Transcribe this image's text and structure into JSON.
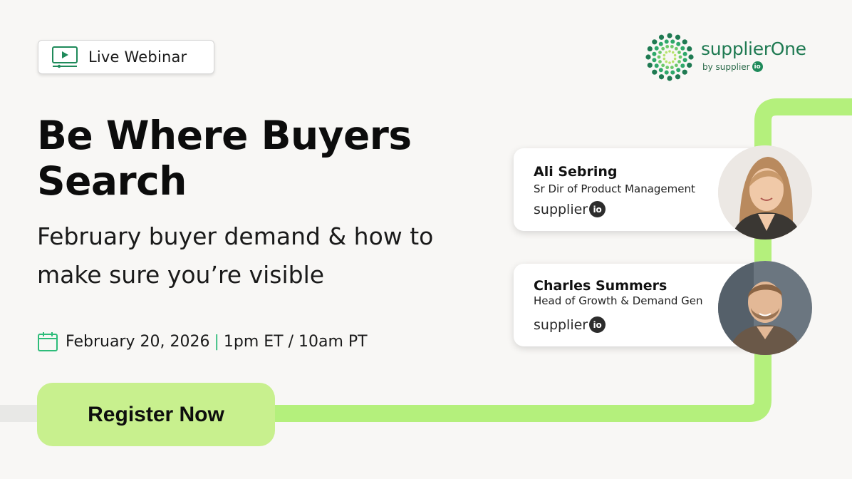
{
  "badge": {
    "label": "Live Webinar",
    "icon": "video-play-icon"
  },
  "logo": {
    "name": "supplierOne",
    "byline": "by supplier",
    "byline_mark": "io"
  },
  "headline": {
    "title": "Be Where Buyers Search"
  },
  "subheadline": {
    "text": "February buyer demand & how to make sure you’re visible"
  },
  "event": {
    "date": "February 20, 2026",
    "separator": "|",
    "time": "1pm ET / 10am PT",
    "icon": "calendar-icon"
  },
  "cta": {
    "label": "Register Now"
  },
  "speakers": [
    {
      "name": "Ali Sebring",
      "role": "Sr Dir of Product Management",
      "org": "supplier",
      "org_mark": "io"
    },
    {
      "name": "Charles Summers",
      "role": "Head of Growth & Demand Gen",
      "org": "supplier",
      "org_mark": "io"
    }
  ],
  "colors": {
    "background": "#f8f7f5",
    "brand_green": "#1f7a52",
    "accent_lime": "#c8f08e",
    "rail_green": "#2ed67f",
    "rail_lime": "#a8ee7a"
  }
}
